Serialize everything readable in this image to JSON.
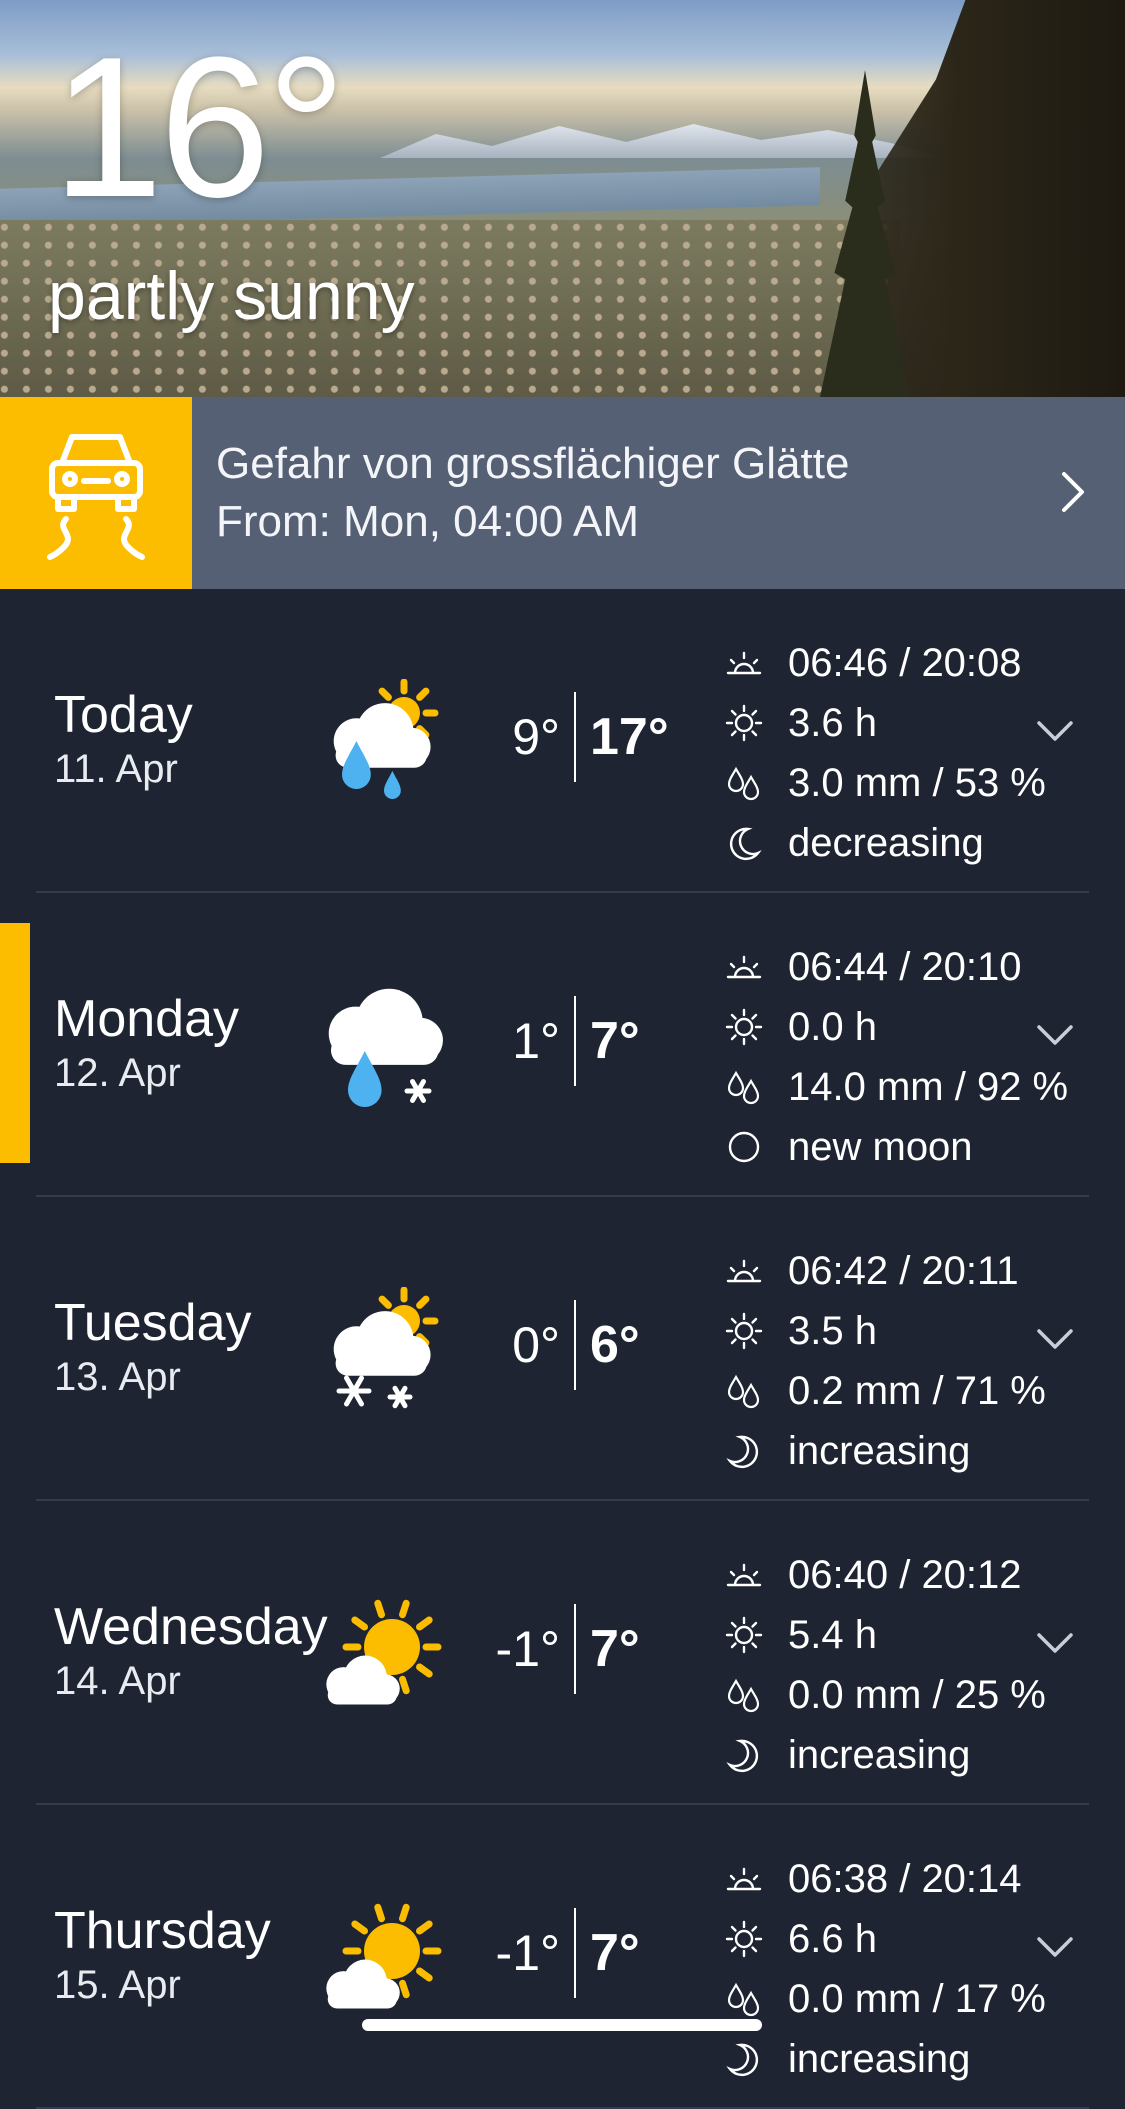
{
  "current": {
    "temperature": "16°",
    "condition": "partly sunny"
  },
  "warning": {
    "icon": "slippery-road-car-icon",
    "title": "Gefahr von grossflächiger Glätte",
    "from": "From: Mon, 04:00 AM"
  },
  "colors": {
    "accent": "#fcbd00",
    "background": "#1e2431",
    "warning_bar": "#566075",
    "rain": "#4fb2f0"
  },
  "forecast": [
    {
      "day": "Today",
      "date": "11. Apr",
      "icon": "sun-cloud-rain-icon",
      "min": "9°",
      "max": "17°",
      "sunrise_sunset": "06:46 / 20:08",
      "sunshine": "3.6 h",
      "precipitation": "3.0 mm / 53 %",
      "moon": "decreasing",
      "moon_icon": "waning-moon-icon",
      "selected": false
    },
    {
      "day": "Monday",
      "date": "12. Apr",
      "icon": "cloud-rain-snow-icon",
      "min": "1°",
      "max": "7°",
      "sunrise_sunset": "06:44 / 20:10",
      "sunshine": "0.0 h",
      "precipitation": "14.0 mm / 92 %",
      "moon": "new moon",
      "moon_icon": "new-moon-icon",
      "selected": true
    },
    {
      "day": "Tuesday",
      "date": "13. Apr",
      "icon": "sun-cloud-snow-icon",
      "min": "0°",
      "max": "6°",
      "sunrise_sunset": "06:42 / 20:11",
      "sunshine": "3.5 h",
      "precipitation": "0.2 mm / 71 %",
      "moon": "increasing",
      "moon_icon": "waxing-moon-icon",
      "selected": false
    },
    {
      "day": "Wednesday",
      "date": "14. Apr",
      "icon": "mostly-sunny-icon",
      "min": "-1°",
      "max": "7°",
      "sunrise_sunset": "06:40 / 20:12",
      "sunshine": "5.4 h",
      "precipitation": "0.0 mm / 25 %",
      "moon": "increasing",
      "moon_icon": "waxing-moon-icon",
      "selected": false
    },
    {
      "day": "Thursday",
      "date": "15. Apr",
      "icon": "mostly-sunny-icon",
      "min": "-1°",
      "max": "7°",
      "sunrise_sunset": "06:38 / 20:14",
      "sunshine": "6.6 h",
      "precipitation": "0.0 mm / 17 %",
      "moon": "increasing",
      "moon_icon": "waxing-moon-icon",
      "selected": false
    }
  ]
}
